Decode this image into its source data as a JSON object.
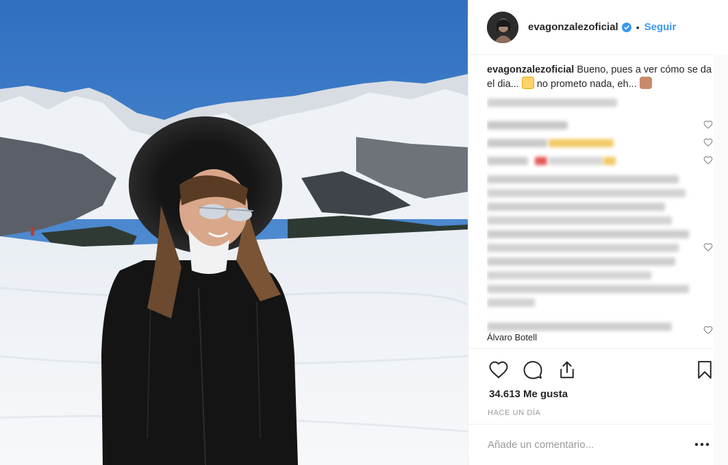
{
  "post": {
    "username": "evagonzalezoficial",
    "follow_label": "Seguir",
    "separator": "•",
    "caption_user": "evagonzalezoficial",
    "caption_text_1": "Bueno, pues a ver cómo se da el dia...",
    "caption_text_2": "no prometo nada, eh...",
    "likes": "34.613 Me gusta",
    "time": "HACE UN DÍA",
    "comment_placeholder": "Añade un comentario...",
    "hidden_comment_name": "Álvaro Botell"
  },
  "icons": {
    "verified": "verified-badge-icon",
    "like": "heart-icon",
    "comment": "comment-icon",
    "share": "share-icon",
    "save": "bookmark-icon",
    "more": "more-options-icon"
  },
  "colors": {
    "link": "#3897f0",
    "text": "#262626",
    "muted": "#999999"
  }
}
